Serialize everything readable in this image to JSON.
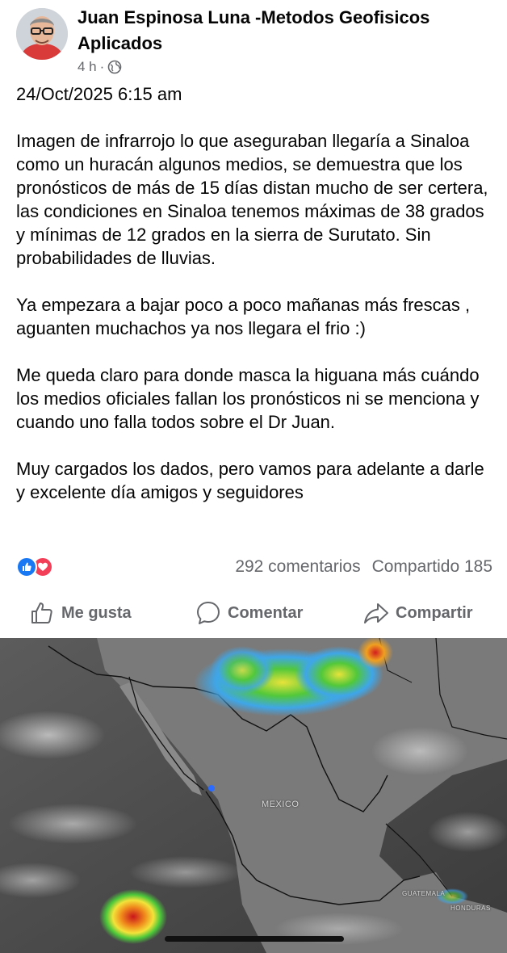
{
  "post": {
    "author": "Juan Espinosa Luna -Metodos Geofisicos Aplicados",
    "time_ago": "4 h",
    "separator": "·",
    "date_line": "24/Oct/2025 6:15 am",
    "paragraphs": [
      "Imagen de infrarrojo lo que aseguraban llegaría a Sinaloa como un huracán algunos medios, se demuestra que los pronósticos de más de 15 días distan mucho de ser certera, las condiciones en Sinaloa tenemos máximas de 38 grados y mínimas de 12 grados en la sierra de Surutato. Sin probabilidades de lluvias.",
      "Ya empezara a bajar poco a poco mañanas más frescas , aguanten muchachos ya nos llegara el frio :)",
      "Me queda claro para donde masca la higuana más cuándo los medios oficiales fallan los pronósticos ni se menciona y cuando uno falla todos sobre el Dr Juan.",
      "Muy cargados los dados, pero vamos para adelante a darle y excelente día amigos y seguidores"
    ]
  },
  "stats": {
    "comments": "292 comentarios",
    "shares": "Compartido 185"
  },
  "actions": {
    "like": "Me gusta",
    "comment": "Comentar",
    "share": "Compartir"
  },
  "image": {
    "country_label": "MEXICO",
    "label_guatemala": "GUATEMALA",
    "label_honduras": "HONDURAS"
  },
  "colors": {
    "like_blue": "#1877f2",
    "love_red": "#f33e58",
    "secondary_text": "#65676b"
  }
}
